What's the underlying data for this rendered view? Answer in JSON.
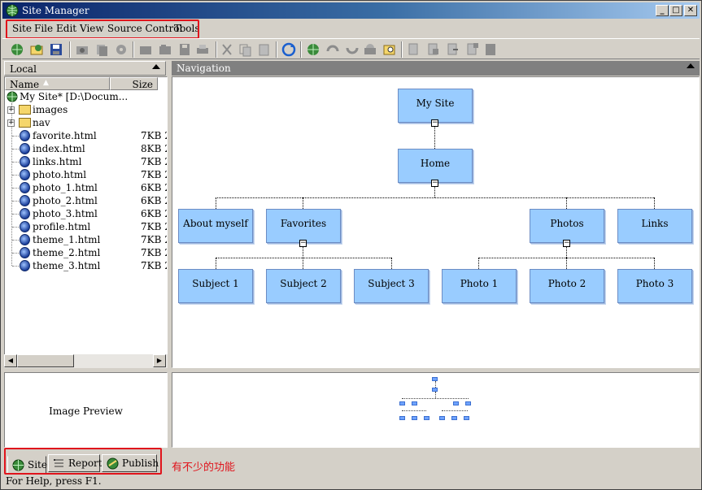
{
  "window": {
    "title": "Site Manager"
  },
  "menu": {
    "items": [
      "Site",
      "File",
      "Edit",
      "View",
      "Source Control",
      "Tools"
    ]
  },
  "left_pane": {
    "header": "Local",
    "columns": {
      "name": "Name",
      "size": "Size"
    },
    "root": "My Site* [D:\\Docum...",
    "folders": [
      "images",
      "nav"
    ],
    "files": [
      {
        "name": "favorite.html",
        "size": "7KB 2"
      },
      {
        "name": "index.html",
        "size": "8KB 2"
      },
      {
        "name": "links.html",
        "size": "7KB 2"
      },
      {
        "name": "photo.html",
        "size": "7KB 2"
      },
      {
        "name": "photo_1.html",
        "size": "6KB 2"
      },
      {
        "name": "photo_2.html",
        "size": "6KB 2"
      },
      {
        "name": "photo_3.html",
        "size": "6KB 2"
      },
      {
        "name": "profile.html",
        "size": "7KB 2"
      },
      {
        "name": "theme_1.html",
        "size": "7KB 2"
      },
      {
        "name": "theme_2.html",
        "size": "7KB 2"
      },
      {
        "name": "theme_3.html",
        "size": "7KB 2"
      }
    ]
  },
  "navigation": {
    "header": "Navigation",
    "root": "My Site",
    "home": "Home",
    "level1": [
      "About myself",
      "Favorites",
      "Photos",
      "Links"
    ],
    "favorites_children": [
      "Subject 1",
      "Subject 2",
      "Subject 3"
    ],
    "photos_children": [
      "Photo 1",
      "Photo 2",
      "Photo 3"
    ]
  },
  "preview": {
    "label": "Image Preview"
  },
  "tabs": [
    "Site",
    "Report",
    "Publish"
  ],
  "annotation": "有不少的功能",
  "status": "For Help, press F1.",
  "colors": {
    "node_fill": "#99ccff",
    "highlight": "#e0141c",
    "titlebar": "#0a246a"
  }
}
